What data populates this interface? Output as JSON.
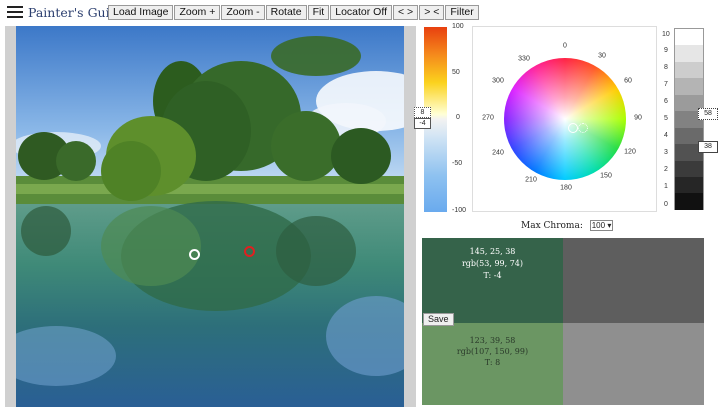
{
  "app": {
    "title": "Painter's Guide"
  },
  "toolbar": {
    "buttons": [
      "Load Image",
      "Zoom +",
      "Zoom -",
      "Rotate",
      "Fit",
      "Locator Off",
      "< >",
      "> <",
      "Filter"
    ]
  },
  "value_bar": {
    "scale_labels": [
      "100",
      "50",
      "0",
      "-50",
      "-100"
    ],
    "markers": [
      {
        "label": "8",
        "style": "dotted"
      },
      {
        "label": "-4",
        "style": "solid"
      }
    ]
  },
  "hue_wheel": {
    "angle_labels": [
      "0",
      "30",
      "60",
      "90",
      "120",
      "150",
      "180",
      "210",
      "240",
      "270",
      "300",
      "330"
    ]
  },
  "chroma": {
    "label": "Max Chroma:",
    "selected": "100"
  },
  "gray_scale": {
    "labels": [
      "10",
      "9",
      "8",
      "7",
      "6",
      "5",
      "4",
      "3",
      "2",
      "1",
      "0"
    ],
    "markers": [
      {
        "label": "58",
        "style": "dotted"
      },
      {
        "label": "38",
        "style": "solid"
      }
    ]
  },
  "samples": {
    "primary": {
      "hct": "145, 25, 38",
      "rgb": "rgb(53, 99, 74)",
      "tone": "T: -4",
      "color": "#35634a"
    },
    "secondary": {
      "hct": "123, 39, 58",
      "rgb": "rgb(107, 150, 99)",
      "tone": "T: 8",
      "color": "#6b9663"
    },
    "primary_gray": "#5e5e5e",
    "secondary_gray": "#8f8f8f",
    "save_label": "Save"
  }
}
